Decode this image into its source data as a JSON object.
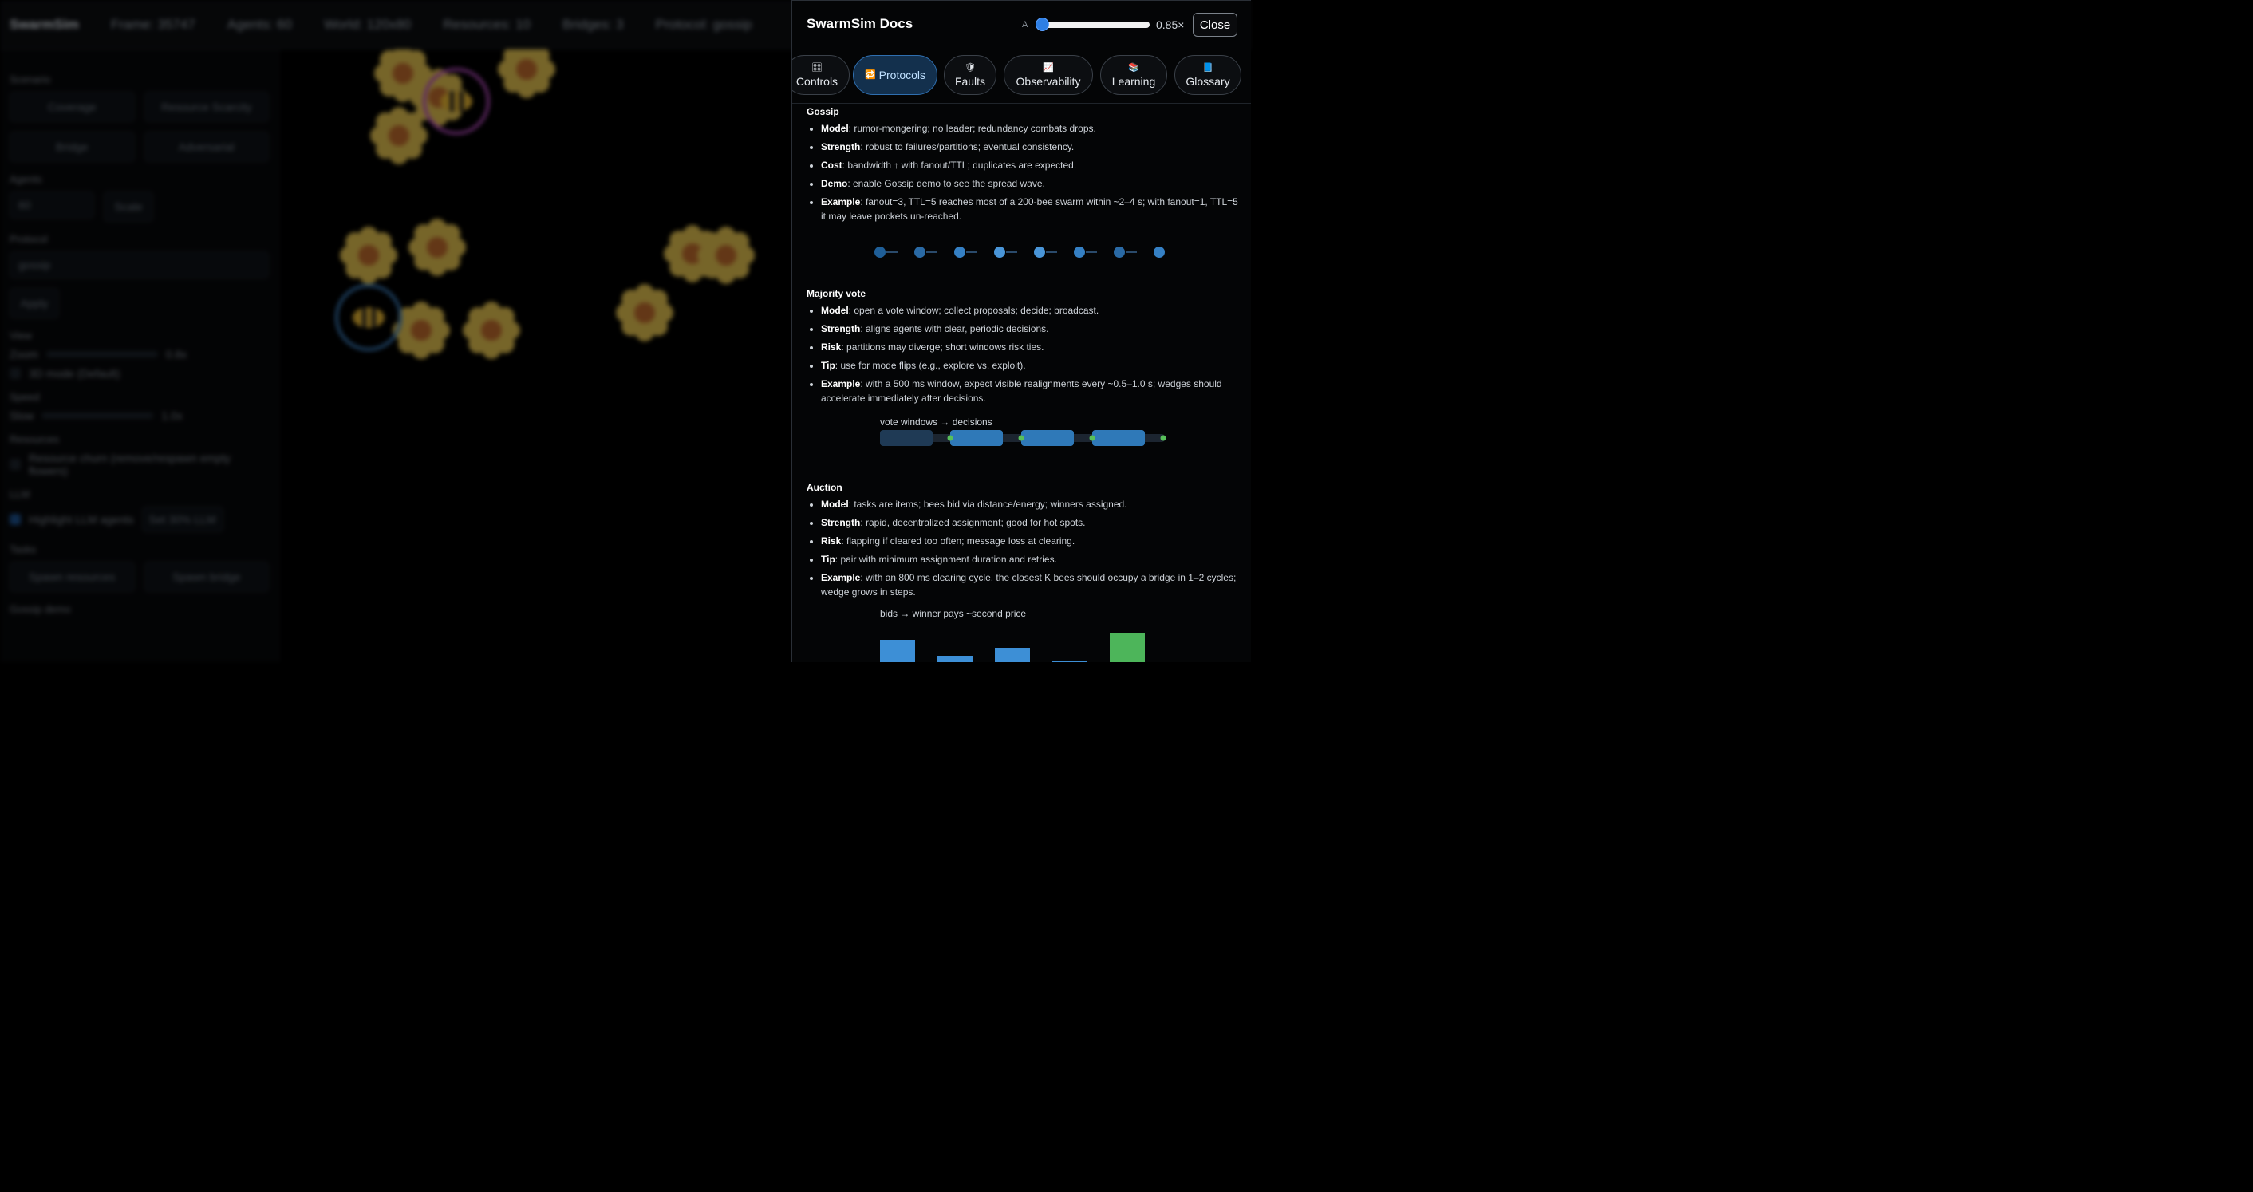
{
  "background": {
    "topbar": {
      "brand": "SwarmSim",
      "stats": [
        "Frame: 35747",
        "Agents: 60",
        "World: 120x80",
        "Resources: 10",
        "Bridges: 3",
        "Protocol: gossip"
      ]
    },
    "sidebar": {
      "scenario_label": "Scenario",
      "scenario_buttons": [
        "Coverage",
        "Resource Scarcity",
        "Bridge",
        "Adversarial"
      ],
      "agents_label": "Agents",
      "agents_value": "60",
      "agents_button": "Scale",
      "protocol_label": "Protocol",
      "protocol_value": "gossip",
      "protocol_button": "Apply",
      "view_label": "View",
      "view_slider_left": "Zoom",
      "view_slider_right": "0.8x",
      "view_checkbox": "3D mode (Default)",
      "speed_label": "Speed",
      "speed_slider_left": "Slow",
      "speed_slider_right": "1.0x",
      "resources_label": "Resources",
      "resources_checkbox": "Resource churn (remove/respawn empty flowers)",
      "llm_label": "LLM",
      "llm_checkbox": "Highlight LLM agents",
      "llm_button": "Set 30% LLM",
      "tasks_label": "Tasks",
      "tasks_buttons": [
        "Spawn resources",
        "Spawn bridge"
      ],
      "bottom_label": "Gossip demo"
    }
  },
  "docs": {
    "title": "SwarmSim Docs",
    "font_size_label": "A",
    "font_scale": 0.85,
    "font_scale_text": "0.85×",
    "close_label": "Close",
    "tabs": [
      {
        "label": "Controls",
        "icon": "🎛"
      },
      {
        "label": "Protocols",
        "icon": "🔁",
        "active": true
      },
      {
        "label": "Faults",
        "icon": "🛡"
      },
      {
        "label": "Observability",
        "icon": "📈"
      },
      {
        "label": "Learning",
        "icon": "📚"
      },
      {
        "label": "Glossary",
        "icon": "📘"
      }
    ],
    "sections": {
      "gossip": {
        "title": "Gossip",
        "points": [
          {
            "term": "Model",
            "text": ": rumor-mongering; no leader; redundancy combats drops."
          },
          {
            "term": "Strength",
            "text": ": robust to failures/partitions; eventual consistency."
          },
          {
            "term": "Cost",
            "text": ": bandwidth ↑ with fanout/TTL; duplicates are expected."
          },
          {
            "term": "Demo",
            "text": ": enable Gossip demo to see the spread wave."
          },
          {
            "term": "Example",
            "text": ": fanout=3, TTL=5 reaches most of a 200-bee swarm within ~2–4 s; with fanout=1, TTL=5 it may leave pockets un-reached."
          }
        ]
      },
      "majority": {
        "title": "Majority vote",
        "points": [
          {
            "term": "Model",
            "text": ": open a vote window; collect proposals; decide; broadcast."
          },
          {
            "term": "Strength",
            "text": ": aligns agents with clear, periodic decisions."
          },
          {
            "term": "Risk",
            "text": ": partitions may diverge; short windows risk ties."
          },
          {
            "term": "Tip",
            "text": ": use for mode flips (e.g., explore vs. exploit)."
          },
          {
            "term": "Example",
            "text": ": with a 500 ms window, expect visible realignments every ~0.5–1.0 s; wedges should accelerate immediately after decisions."
          }
        ],
        "viz_label": "vote windows → decisions"
      },
      "auction": {
        "title": "Auction",
        "points": [
          {
            "term": "Model",
            "text": ": tasks are items; bees bid via distance/energy; winners assigned."
          },
          {
            "term": "Strength",
            "text": ": rapid, decentralized assignment; good for hot spots."
          },
          {
            "term": "Risk",
            "text": ": flapping if cleared too often; message loss at clearing."
          },
          {
            "term": "Tip",
            "text": ": pair with minimum assignment duration and retries."
          },
          {
            "term": "Example",
            "text": ": with an 800 ms clearing cycle, the closest K bees should occupy a bridge in 1–2 cycles; wedge grows in steps."
          }
        ],
        "viz_label": "bids → winner pays ~second price"
      }
    }
  },
  "colors": {
    "accent": "#2e7fe5",
    "node": "#1f5f98",
    "window": "#2f79b8",
    "decision": "#58c05a",
    "winner": "#4db55a",
    "bid": "#3d8fd6"
  }
}
